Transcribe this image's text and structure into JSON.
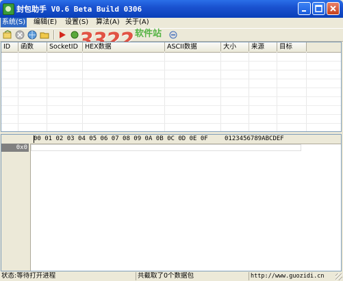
{
  "window": {
    "title": "封包助手 V0.6 Beta Build 0306",
    "controls": {
      "minimize": "_",
      "maximize": "□",
      "close": "X"
    }
  },
  "menu": [
    {
      "label": "系统(S)"
    },
    {
      "label": "编辑(E)"
    },
    {
      "label": "设置(S)"
    },
    {
      "label": "算法(A)"
    },
    {
      "label": "关于(A)"
    }
  ],
  "watermark": {
    "number": "3322",
    "domain": ".cc",
    "site": "软件站"
  },
  "packet_list": {
    "columns": [
      "ID",
      "函数",
      "SocketID",
      "HEX数据",
      "ASCII数据",
      "大小",
      "来源",
      "目标"
    ]
  },
  "hex_view": {
    "header_hex": "00 01 02 03 04 05 06 07 08 09 0A 0B 0C 0D 0E 0F",
    "header_ascii": "0123456789ABCDEF",
    "row_offset": "0x0"
  },
  "status_bar": {
    "state": "状态:等待打开进程",
    "captured": "共截取了0个数据包",
    "url": "http://www.guozidi.cn"
  },
  "colors": {
    "title_bar": "#0a3fb8",
    "menu_highlight": "#316ac5",
    "chrome": "#ece9d8"
  }
}
